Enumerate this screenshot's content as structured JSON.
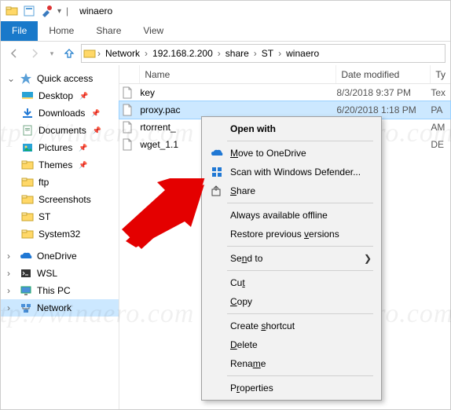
{
  "window": {
    "title": "winaero"
  },
  "ribbon": {
    "file": "File",
    "tabs": [
      "Home",
      "Share",
      "View"
    ]
  },
  "address": {
    "segments": [
      "Network",
      "192.168.2.200",
      "share",
      "ST",
      "winaero"
    ]
  },
  "sidebar": {
    "quick_access": {
      "label": "Quick access",
      "items": [
        {
          "label": "Desktop",
          "pinned": true
        },
        {
          "label": "Downloads",
          "pinned": true
        },
        {
          "label": "Documents",
          "pinned": true
        },
        {
          "label": "Pictures",
          "pinned": true
        },
        {
          "label": "Themes",
          "pinned": true
        },
        {
          "label": "ftp",
          "pinned": false
        },
        {
          "label": "Screenshots",
          "pinned": false
        },
        {
          "label": "ST",
          "pinned": false
        },
        {
          "label": "System32",
          "pinned": false
        }
      ]
    },
    "other": [
      {
        "label": "OneDrive"
      },
      {
        "label": "WSL"
      },
      {
        "label": "This PC"
      },
      {
        "label": "Network",
        "selected": true
      }
    ]
  },
  "filepane": {
    "columns": {
      "name": "Name",
      "date": "Date modified",
      "type": "Ty"
    },
    "rows": [
      {
        "name": "key",
        "date": "8/3/2018 9:37 PM",
        "type": "Tex"
      },
      {
        "name": "proxy.pac",
        "date": "6/20/2018 1:18 PM",
        "type": "PA",
        "selected": true
      },
      {
        "name": "rtorrent_",
        "date": "",
        "type": "AM"
      },
      {
        "name": "wget_1.1",
        "date": "",
        "type": "DE"
      }
    ]
  },
  "context_menu": {
    "open_with": "Open with",
    "move_onedrive": "Move to OneDrive",
    "scan_defender": "Scan with Windows Defender...",
    "share": "Share",
    "always_offline": "Always available offline",
    "restore_versions": "Restore previous versions",
    "send_to": "Send to",
    "cut": "Cut",
    "copy": "Copy",
    "create_shortcut": "Create shortcut",
    "delete": "Delete",
    "rename": "Rename",
    "properties": "Properties"
  },
  "watermark": "http://winaero.com"
}
